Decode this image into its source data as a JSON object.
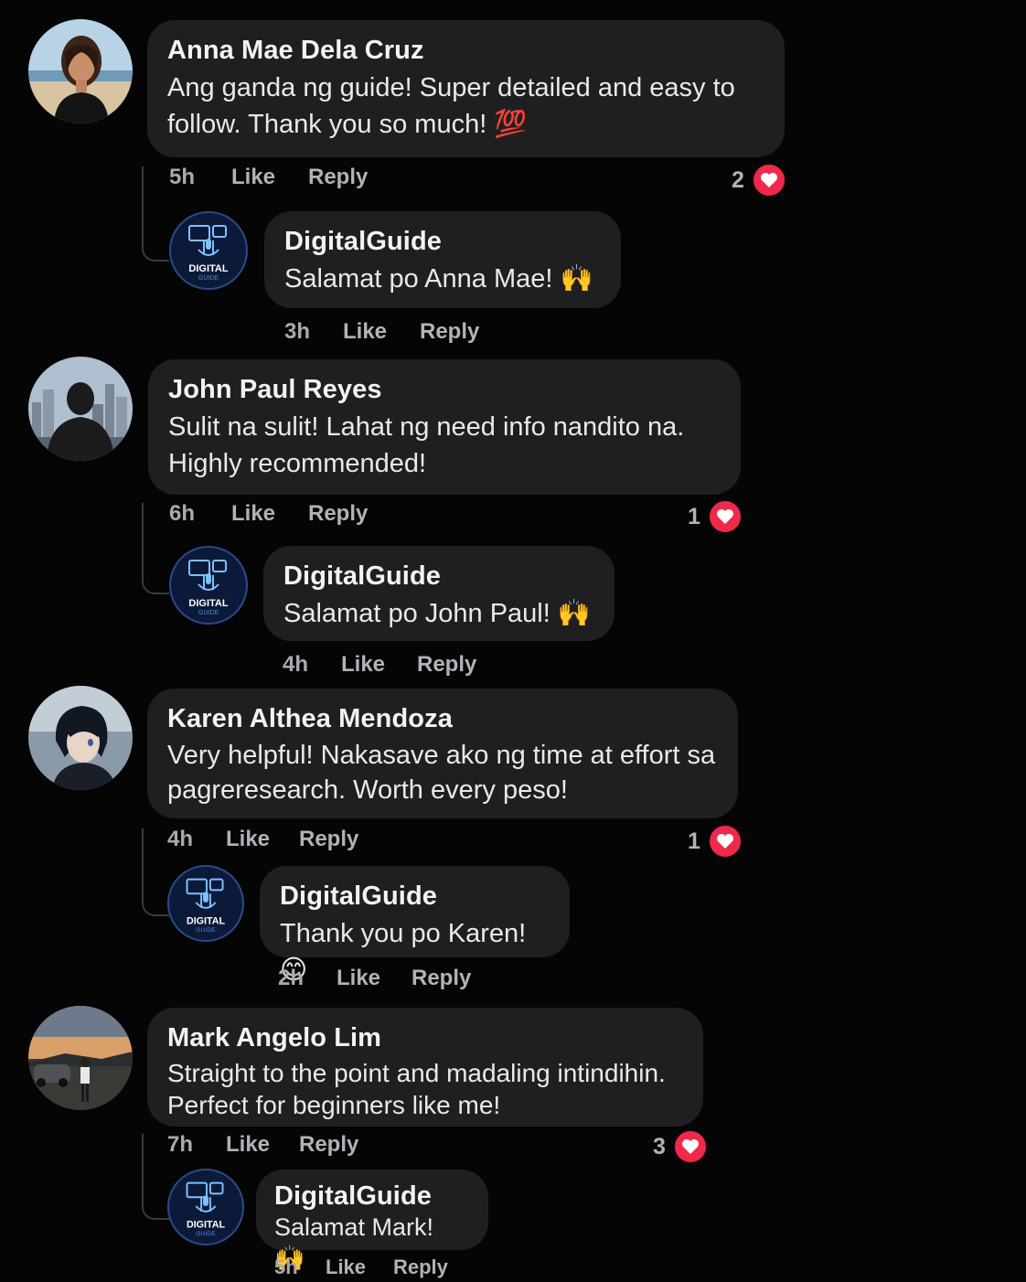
{
  "comments": [
    {
      "author": "Anna Mae Dela Cruz",
      "text": "Ang ganda ng guide! Super detailed and easy to follow. Thank you so much! 💯",
      "time": "5h",
      "like": "Like",
      "reply": "Reply",
      "reactions": "2",
      "avatar_icon": "woman-beach-photo",
      "response": {
        "author": "DigitalGuide",
        "text": "Salamat po Anna Mae! 🙌",
        "time": "3h",
        "like": "Like",
        "reply": "Reply"
      }
    },
    {
      "author": "John Paul Reyes",
      "text": "Sulit na sulit! Lahat ng need info nandito na. Highly recommended!",
      "time": "6h",
      "like": "Like",
      "reply": "Reply",
      "reactions": "1",
      "avatar_icon": "man-city-skyline-photo",
      "response": {
        "author": "DigitalGuide",
        "text": "Salamat po John Paul! 🙌",
        "time": "4h",
        "like": "Like",
        "reply": "Reply"
      }
    },
    {
      "author": "Karen Althea Mendoza",
      "text": "Very helpful! Nakasave ako ng time at effort sa pagreresearch. Worth every peso!",
      "time": "4h",
      "like": "Like",
      "reply": "Reply",
      "reactions": "1",
      "avatar_icon": "anime-character-avatar",
      "response": {
        "author": "DigitalGuide",
        "text": "Thank you po Karen! 😊",
        "time": "2h",
        "like": "Like",
        "reply": "Reply"
      }
    },
    {
      "author": "Mark Angelo Lim",
      "text": "Straight to the point and madaling intindihin. Perfect for beginners like me!",
      "time": "7h",
      "like": "Like",
      "reply": "Reply",
      "reactions": "3",
      "avatar_icon": "man-sunset-car-photo",
      "response": {
        "author": "DigitalGuide",
        "text": "Salamat Mark! 🙌",
        "time": "5h",
        "like": "Like",
        "reply": "Reply"
      }
    }
  ],
  "brand_logo": {
    "line1": "DIGITAL",
    "line2": "GUIDE"
  },
  "colors": {
    "background": "#050506",
    "bubble": "#1f1f21",
    "heart": "#f0284a",
    "muted": "#b0b3b8"
  },
  "icons": {
    "reaction": "heart-icon",
    "page_logo": "digitalguide-logo"
  }
}
